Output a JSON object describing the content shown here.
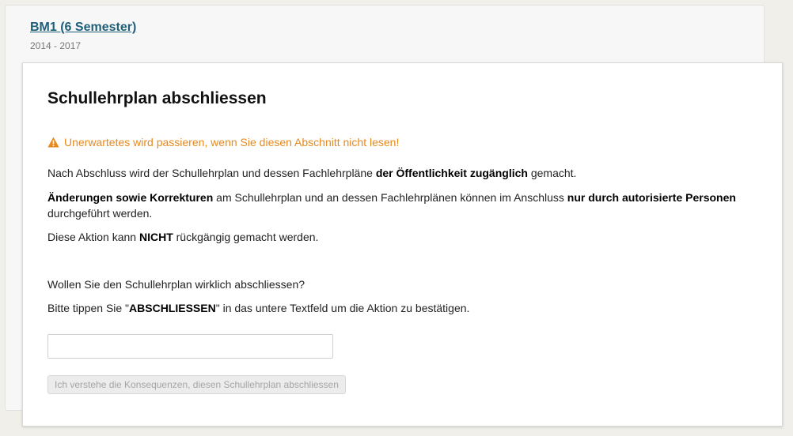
{
  "background": {
    "title": "BM1 (6 Semester)",
    "subtitle": "2014 - 2017"
  },
  "modal": {
    "title": "Schullehrplan abschliessen",
    "warning": "Unerwartetes wird passieren, wenn Sie diesen Abschnitt nicht lesen!",
    "p1": {
      "a": "Nach Abschluss wird der Schullehrplan und dessen Fachlehrpläne ",
      "b": "der Öffentlichkeit zugänglich",
      "c": " gemacht."
    },
    "p2": {
      "a": "Änderungen sowie Korrekturen",
      "b": " am Schullehrplan und an dessen Fachlehrplänen können im Anschluss ",
      "c": "nur durch autorisierte Personen",
      "d": " durchgeführt werden."
    },
    "p3": {
      "a": "Diese Aktion kann ",
      "b": "NICHT",
      "c": " rückgängig gemacht werden."
    },
    "question": "Wollen Sie den Schullehrplan wirklich abschliessen?",
    "instruction": {
      "a": "Bitte tippen Sie \"",
      "b": "ABSCHLIESSEN",
      "c": "\" in das untere Textfeld um die Aktion zu bestätigen."
    },
    "input": {
      "value": "",
      "placeholder": ""
    },
    "confirm_button": "Ich verstehe die Konsequenzen, diesen Schullehrplan abschliessen"
  },
  "colors": {
    "warning": "#e8891d",
    "link": "#1f5f7a",
    "disabled_text": "#a5a5a5"
  },
  "icons": {
    "warning": "warning-triangle-icon"
  }
}
